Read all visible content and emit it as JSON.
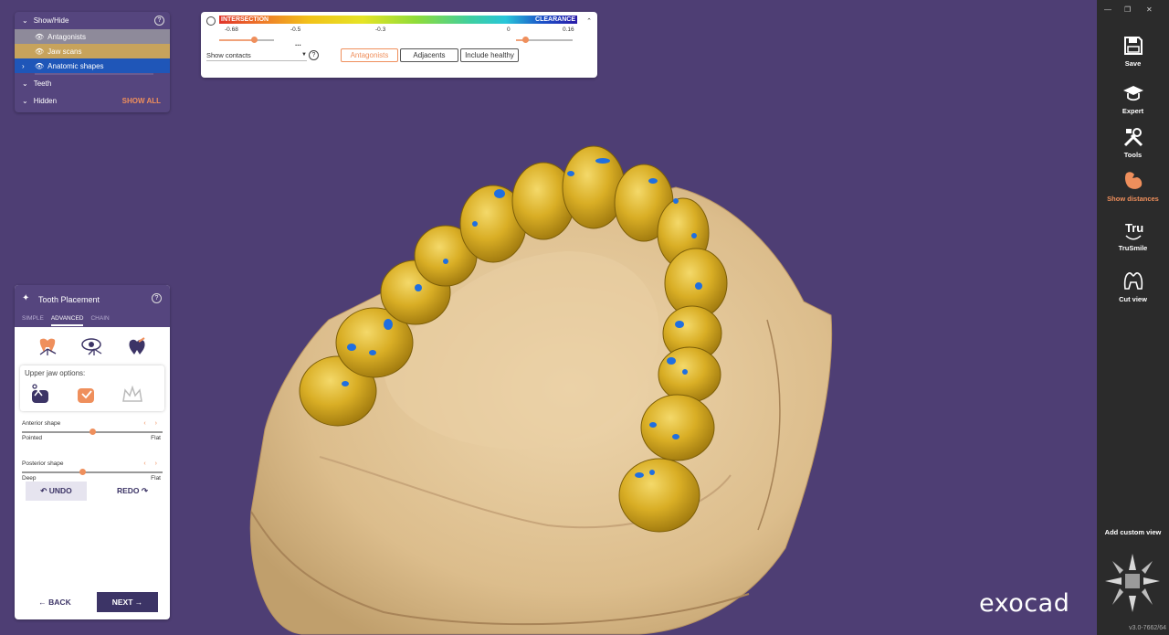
{
  "showhide": {
    "title": "Show/Hide",
    "items": [
      {
        "label": "Antagonists"
      },
      {
        "label": "Jaw scans"
      },
      {
        "label": "Anatomic shapes"
      }
    ],
    "teeth": "Teeth",
    "hidden": "Hidden",
    "show_all": "SHOW ALL"
  },
  "legend": {
    "left_label": "INTERSECTION",
    "right_label": "CLEARANCE",
    "ticks": [
      "-0.68",
      "-0.5",
      "-0.3",
      "0",
      "0.16"
    ],
    "dots": "...",
    "select_value": "Show contacts",
    "pills": [
      "Antagonists",
      "Adjacents",
      "Include healthy"
    ]
  },
  "placement": {
    "title": "Tooth Placement",
    "tabs": [
      "SIMPLE",
      "ADVANCED",
      "CHAIN"
    ],
    "upper_label": "Upper jaw options:",
    "anterior": {
      "name": "Anterior shape",
      "lo": "Pointed",
      "hi": "Flat",
      "value": 0.5
    },
    "posterior": {
      "name": "Posterior shape",
      "lo": "Deep",
      "hi": "Flat",
      "value": 0.43
    },
    "undo": "UNDO",
    "redo": "REDO",
    "back": "BACK",
    "next": "NEXT"
  },
  "toolbar": {
    "items": [
      {
        "label": "Save",
        "icon": "save-icon"
      },
      {
        "label": "Expert",
        "icon": "graduation-cap-icon"
      },
      {
        "label": "Tools",
        "icon": "tools-icon"
      },
      {
        "label": "Show distances",
        "icon": "show-distances-icon"
      },
      {
        "label": "TruSmile",
        "icon": "trusmile-icon"
      },
      {
        "label": "Cut view",
        "icon": "cut-view-icon"
      }
    ],
    "custom_view": "Add custom view",
    "version": "v3.0-7662/64"
  },
  "brand": "exocad",
  "colors": {
    "panel_purple": "#55457e",
    "viewport": "#4e3e74",
    "accent": "#ef8f5c",
    "tooth_gold": "#d4aa22",
    "model_tan": "#e3c89a",
    "contact_blue": "#1f6fe0"
  }
}
